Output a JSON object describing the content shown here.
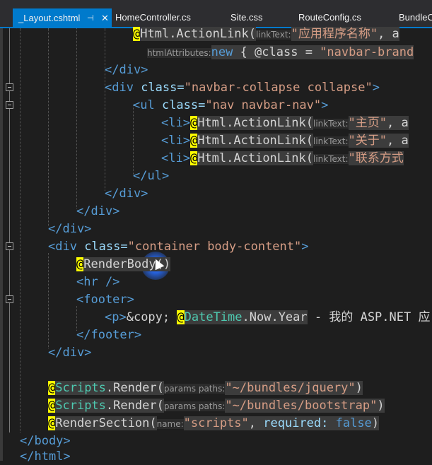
{
  "tabs": [
    {
      "label": "_Layout.cshtml",
      "active": true,
      "pin": "⊣",
      "close": "✕"
    },
    {
      "label": "HomeController.cs"
    },
    {
      "label": "Site.css"
    },
    {
      "label": "RouteConfig.cs"
    },
    {
      "label": "BundleC"
    }
  ],
  "code": {
    "l1": {
      "razor": "@",
      "method": "Html.ActionLink",
      "paren": "(",
      "hint": "linkText:",
      "str": "\"应用程序名称\"",
      "rest": ", a"
    },
    "l2": {
      "hint": "htmlAttributes:",
      "kw": "new",
      "rest": " { @class = ",
      "str": "\"navbar-brand"
    },
    "l3": {
      "text": "</div>"
    },
    "l4": {
      "open": "<div",
      "attr": " class=",
      "str": "\"navbar-collapse collapse\"",
      "close": ">"
    },
    "l5": {
      "open": "<ul",
      "attr": " class=",
      "str": "\"nav navbar-nav\"",
      "close": ">"
    },
    "l6": {
      "li": "<li>",
      "razor": "@",
      "method": "Html.ActionLink",
      "paren": "(",
      "hint": "linkText:",
      "str": "\"主页\"",
      "rest": ", a"
    },
    "l7": {
      "li": "<li>",
      "razor": "@",
      "method": "Html.ActionLink",
      "paren": "(",
      "hint": "linkText:",
      "str": "\"关于\"",
      "rest": ", a"
    },
    "l8": {
      "li": "<li>",
      "razor": "@",
      "method": "Html.ActionLink",
      "paren": "(",
      "hint": "linkText:",
      "str": "\"联系方式"
    },
    "l9": {
      "text": "</ul>"
    },
    "l10": {
      "text": "</div>"
    },
    "l11": {
      "text": "</div>"
    },
    "l12": {
      "text": "</div>"
    },
    "l13": {
      "open": "<div",
      "attr": " class=",
      "str": "\"container body-content\"",
      "close": ">"
    },
    "l14": {
      "razor": "@",
      "method": "RenderBody",
      "paren": "()"
    },
    "l15": {
      "text": "<hr />"
    },
    "l16": {
      "text": "<footer>"
    },
    "l17": {
      "p": "<p>",
      "ent": "&copy; ",
      "razor": "@",
      "type": "DateTime",
      "rest": ".Now.Year",
      "tail": " - 我的 ASP.NET 应"
    },
    "l18": {
      "text": "</footer>"
    },
    "l19": {
      "text": "</div>"
    },
    "l20": {
      "razor": "@",
      "type": "Scripts",
      "method": ".Render",
      "paren": "(",
      "hint": "params paths:",
      "str": "\"~/bundles/jquery\"",
      "end": ")"
    },
    "l21": {
      "razor": "@",
      "type": "Scripts",
      "method": ".Render",
      "paren": "(",
      "hint": "params paths:",
      "str": "\"~/bundles/bootstrap\"",
      "end": ")"
    },
    "l22": {
      "razor": "@",
      "method": "RenderSection",
      "paren": "(",
      "hint": "name:",
      "str": "\"scripts\"",
      "rest": ", ",
      "hint2": "required:",
      "kw": " false",
      "end": ")"
    },
    "l23": {
      "text": "</body>"
    },
    "l24": {
      "text": "</html>"
    }
  }
}
